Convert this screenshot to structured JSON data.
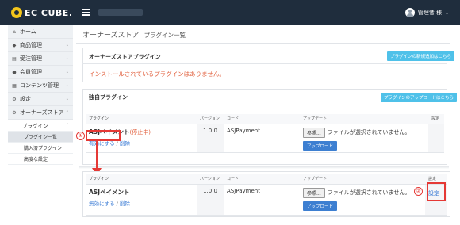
{
  "header": {
    "logo_text": "EC CUBE.",
    "user_name": "管理者 様",
    "caret": "⌄"
  },
  "sidebar": {
    "items": [
      {
        "icon": "⌂",
        "label": "ホーム",
        "chevron": ""
      },
      {
        "icon": "◆",
        "label": "商品管理",
        "chevron": "⌄"
      },
      {
        "icon": "▤",
        "label": "受注管理",
        "chevron": "⌄"
      },
      {
        "icon": "●",
        "label": "会員管理",
        "chevron": "⌄"
      },
      {
        "icon": "▦",
        "label": "コンテンツ管理",
        "chevron": "⌄"
      },
      {
        "icon": "⚙",
        "label": "設定",
        "chevron": "⌄"
      },
      {
        "icon": "⚙",
        "label": "オーナーズストア",
        "chevron": "⌃"
      }
    ],
    "sub_parent": {
      "label": "プラグイン",
      "chevron": "⌃"
    },
    "sub_items": [
      "プラグイン一覧",
      "購入済プラグイン",
      "高度な設定"
    ]
  },
  "page": {
    "title": "オーナーズストア",
    "subtitle": "プラグイン一覧"
  },
  "store_box": {
    "title": "オーナーズストアプラグイン",
    "button": "プラグインの新規追加はこちら",
    "notice": "インストールされているプラグインはありません。"
  },
  "own_box": {
    "title": "独自プラグイン",
    "button": "プラグインのアップロードはこちら"
  },
  "table": {
    "headers": [
      "プラグイン",
      "バージョン",
      "コード",
      "アップデート",
      "設定"
    ]
  },
  "row_before": {
    "name": "ASJペイメント",
    "status": "(停止中)",
    "enable_link": "有効にする",
    "separator": "/",
    "delete_link": "削除",
    "version": "1.0.0",
    "code": "ASJPayment",
    "browse": "参照...",
    "file_text": "ファイルが選択されていません。",
    "upload": "アップロード"
  },
  "row_after": {
    "name": "ASJペイメント",
    "disable_link": "無効にする",
    "separator": "/",
    "delete_link": "削除",
    "version": "1.0.0",
    "code": "ASJPayment",
    "browse": "参照...",
    "file_text": "ファイルが選択されていません。",
    "upload": "アップロード",
    "config_link": "設定"
  },
  "annotations": {
    "step1": "①",
    "step2": "②",
    "accent": "#e53935"
  },
  "colors": {
    "header_bg": "#1f2d3d",
    "info_button": "#4fc1e9",
    "upload_button": "#3d7fd1",
    "notice": "#e15f3c",
    "link": "#3a7bd5"
  }
}
